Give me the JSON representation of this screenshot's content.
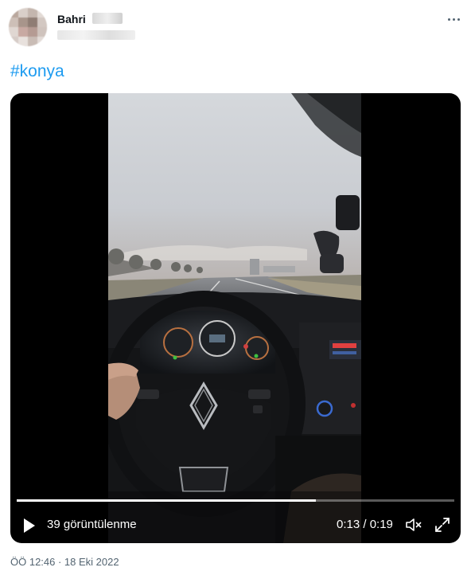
{
  "tweet": {
    "author_name": "Bahri",
    "hashtag": "#konya",
    "timestamp": "ÖÖ 12:46 · 18 Eki 2022"
  },
  "video": {
    "views": "39 görüntülenme",
    "time": "0:13 / 0:19",
    "progress_fraction": 0.684,
    "icons": [
      "play-icon",
      "volume-muted-icon",
      "fullscreen-icon"
    ]
  },
  "colors": {
    "accent": "#1d9bf0",
    "text_primary": "#0f1419",
    "text_secondary": "#536471",
    "video_bg": "#000000"
  }
}
